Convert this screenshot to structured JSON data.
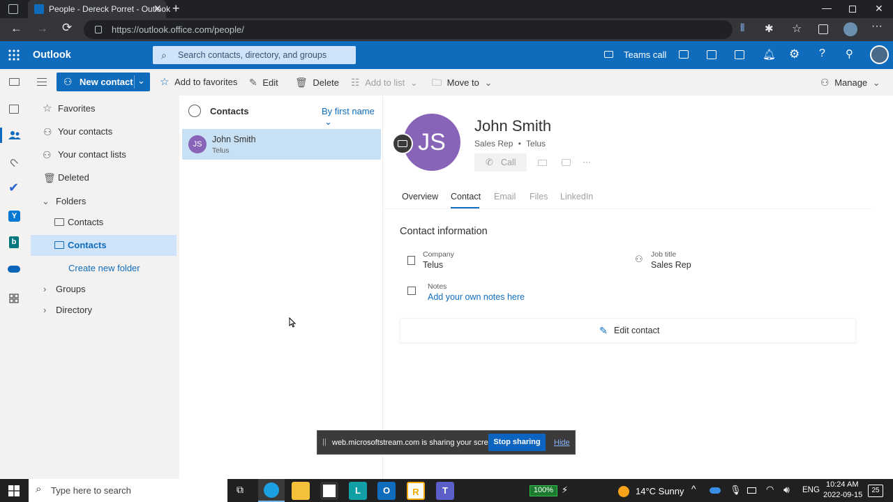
{
  "browser": {
    "tab_title": "People - Dereck Porret - Outlook",
    "url": "https://outlook.office.com/people/"
  },
  "header": {
    "app_name": "Outlook",
    "search_placeholder": "Search contacts, directory, and groups",
    "teams_call_label": "Teams call"
  },
  "command_bar": {
    "new_contact": "New contact",
    "add_to_favorites": "Add to favorites",
    "edit": "Edit",
    "delete": "Delete",
    "add_to_list": "Add to list",
    "move_to": "Move to",
    "manage": "Manage"
  },
  "left_nav": {
    "favorites": "Favorites",
    "your_contacts": "Your contacts",
    "your_contact_lists": "Your contact lists",
    "deleted": "Deleted",
    "folders": "Folders",
    "folder_contacts_1": "Contacts",
    "folder_contacts_2": "Contacts",
    "create_new_folder": "Create new folder",
    "groups": "Groups",
    "directory": "Directory"
  },
  "list": {
    "header": "Contacts",
    "sort": "By first name",
    "items": [
      {
        "initials": "JS",
        "name": "John Smith",
        "company": "Telus"
      }
    ]
  },
  "contact": {
    "initials": "JS",
    "name": "John Smith",
    "job_title": "Sales Rep",
    "company": "Telus",
    "call_label": "Call",
    "more": "···",
    "tabs": [
      "Overview",
      "Contact",
      "Email",
      "Files",
      "LinkedIn"
    ],
    "section_title": "Contact information",
    "company_label": "Company",
    "company_value": "Telus",
    "jobtitle_label": "Job title",
    "jobtitle_value": "Sales Rep",
    "notes_label": "Notes",
    "notes_link": "Add your own notes here",
    "edit_contact": "Edit contact"
  },
  "sharing_bar": {
    "message": "web.microsoftstream.com is sharing your screen.",
    "stop": "Stop sharing",
    "hide": "Hide"
  },
  "taskbar": {
    "search_placeholder": "Type here to search",
    "battery": "100%",
    "weather": "14°C  Sunny",
    "lang": "ENG",
    "time": "10:24 AM",
    "date": "2022-09-15",
    "notifications": "25"
  },
  "colors": {
    "brand": "#0f6cbd",
    "avatar": "#8764b8",
    "selected": "#c7e0f4",
    "link": "#0f6cbd"
  }
}
